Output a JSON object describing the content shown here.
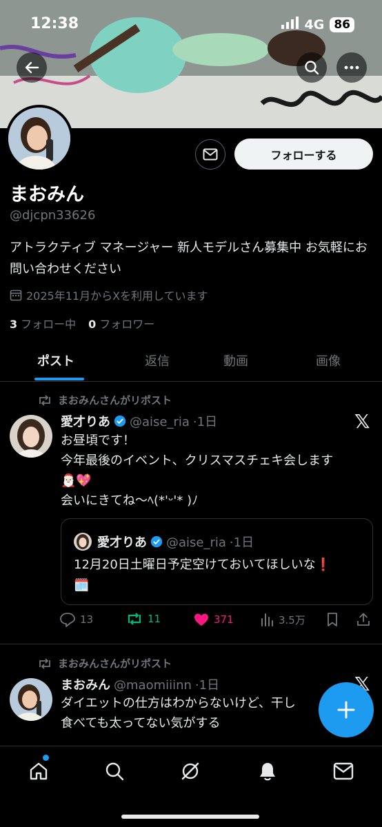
{
  "status_bar": {
    "time": "12:38",
    "network": "4G",
    "battery": "86"
  },
  "profile": {
    "follow_label": "フォローする",
    "display_name": "まおみん",
    "handle": "@djcpn33626",
    "bio": "アトラクティブ マネージャー 新人モデルさん募集中 お気軽にお問い合わせください",
    "joined": "2025年11月からXを利用しています",
    "following_count": "3",
    "following_label": "フォロー中",
    "followers_count": "0",
    "followers_label": "フォロワー"
  },
  "tabs": [
    {
      "label": "ポスト",
      "active": true
    },
    {
      "label": "返信",
      "active": false
    },
    {
      "label": "動画",
      "active": false
    },
    {
      "label": "画像",
      "active": false
    }
  ],
  "posts": [
    {
      "repost_label": "まおみんさんがリポスト",
      "name": "愛才りあ",
      "handle": "@aise_ria",
      "time": "·1日",
      "text_lines": [
        "お昼頃です！",
        "今年最後のイベント、クリスマスチェキ会します",
        "🎅🏻💖",
        "会いにきてね〜ﾍ(*'ᵕ'* )ﾉ"
      ],
      "quote": {
        "name": "愛才りあ",
        "handle": "@aise_ria",
        "time": "·1日",
        "text_line1": "12月20日土曜日予定空けておいてほしいな❗️",
        "text_line2": "🗓️"
      },
      "replies": "13",
      "reposts": "11",
      "likes": "371",
      "views": "3.5万"
    },
    {
      "repost_label": "まおみんさんがリポスト",
      "name": "まおみん",
      "handle": "@maomiiinn",
      "time": "·1日",
      "text_lines": [
        "ダイエットの仕方はわからないけど、干し",
        "食べても太ってない気がする"
      ]
    }
  ],
  "colors": {
    "accent": "#1d9bf0",
    "repost_green": "#00ba7c",
    "like_pink": "#f91880",
    "muted": "#71767b"
  }
}
